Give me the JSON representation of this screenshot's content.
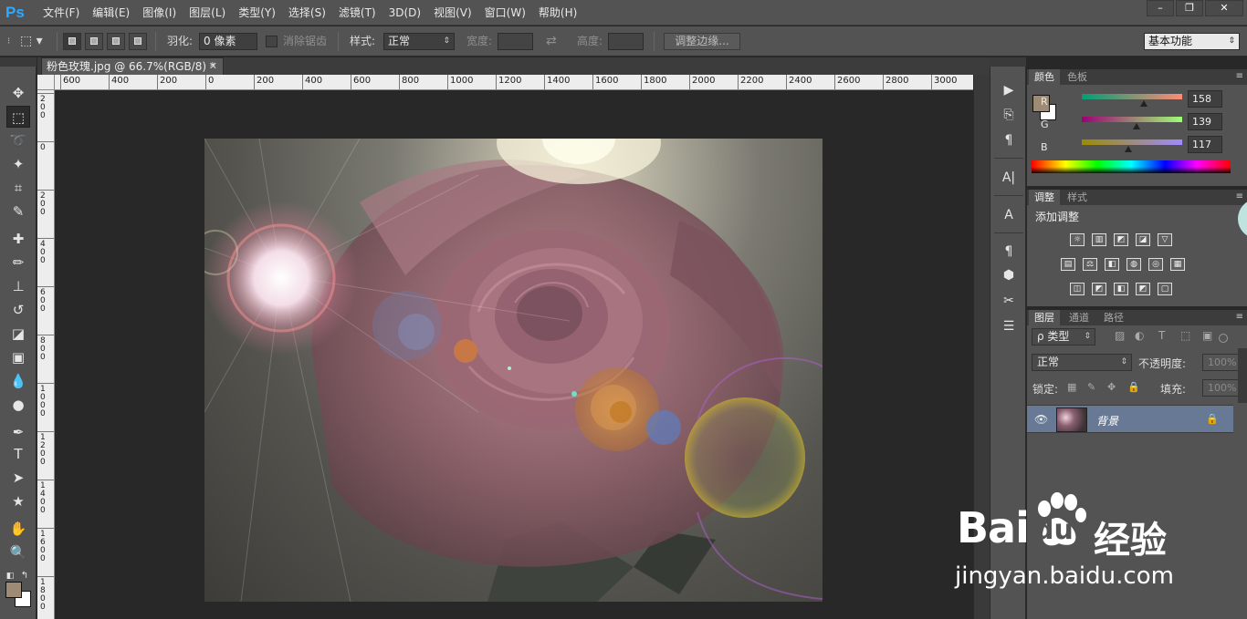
{
  "app": {
    "logo": "Ps",
    "menu": [
      "文件(F)",
      "编辑(E)",
      "图像(I)",
      "图层(L)",
      "类型(Y)",
      "选择(S)",
      "滤镜(T)",
      "3D(D)",
      "视图(V)",
      "窗口(W)",
      "帮助(H)"
    ],
    "window_controls": [
      "–",
      "❐",
      "✕"
    ]
  },
  "options": {
    "feather_label": "羽化:",
    "feather_value": "0 像素",
    "antialias_label": "消除锯齿",
    "style_label": "样式:",
    "style_value": "正常",
    "width_label": "宽度:",
    "height_label": "高度:",
    "refine_edge": "调整边缘...",
    "workspace": "基本功能"
  },
  "document": {
    "tab_title": "粉色玫瑰.jpg @ 66.7%(RGB/8) *",
    "ruler_h": [
      "600",
      "400",
      "200",
      "0",
      "200",
      "400",
      "600",
      "800",
      "1000",
      "1200",
      "1400",
      "1600",
      "1800",
      "2000",
      "2200",
      "2400",
      "2600",
      "2800",
      "3000"
    ],
    "ruler_v": [
      "200",
      "0",
      "200",
      "400",
      "600",
      "800",
      "1000",
      "1200",
      "1400",
      "1600",
      "1800"
    ]
  },
  "color_panel": {
    "tabs": [
      "颜色",
      "色板"
    ],
    "channels": [
      {
        "label": "R",
        "value": "158",
        "fraction": 0.62
      },
      {
        "label": "G",
        "value": "139",
        "fraction": 0.545
      },
      {
        "label": "B",
        "value": "117",
        "fraction": 0.46
      }
    ],
    "foreground": "#9e8b75",
    "background": "#ffffff"
  },
  "adjust_panel": {
    "tabs": [
      "调整",
      "样式"
    ],
    "heading": "添加调整",
    "icons_row1": [
      "brightness-icon",
      "levels-icon",
      "curves-icon",
      "exposure-icon",
      "vibrance-icon"
    ],
    "icons_row2": [
      "hue-saturation-icon",
      "color-balance-icon",
      "black-white-icon",
      "photo-filter-icon",
      "channel-mixer-icon",
      "color-lookup-icon"
    ],
    "icons_row3": [
      "invert-icon",
      "posterize-icon",
      "threshold-icon",
      "selective-color-icon",
      "gradient-map-icon"
    ]
  },
  "layers_panel": {
    "tabs": [
      "图层",
      "通道",
      "路径"
    ],
    "filter_kind": "ρ 类型",
    "blend_mode": "正常",
    "opacity_label": "不透明度:",
    "opacity_value": "100%",
    "lock_label": "锁定:",
    "fill_label": "填充:",
    "fill_value": "100%",
    "layer_name": "背景"
  },
  "watermark": {
    "brand_left": "Bai",
    "brand_right": "du",
    "brand_cn": "经验",
    "url": "jingyan.baidu.com"
  },
  "colors": {
    "ps_blue": "#31a8ff",
    "layer_selected": "#677995",
    "panel_bg": "#535353"
  }
}
